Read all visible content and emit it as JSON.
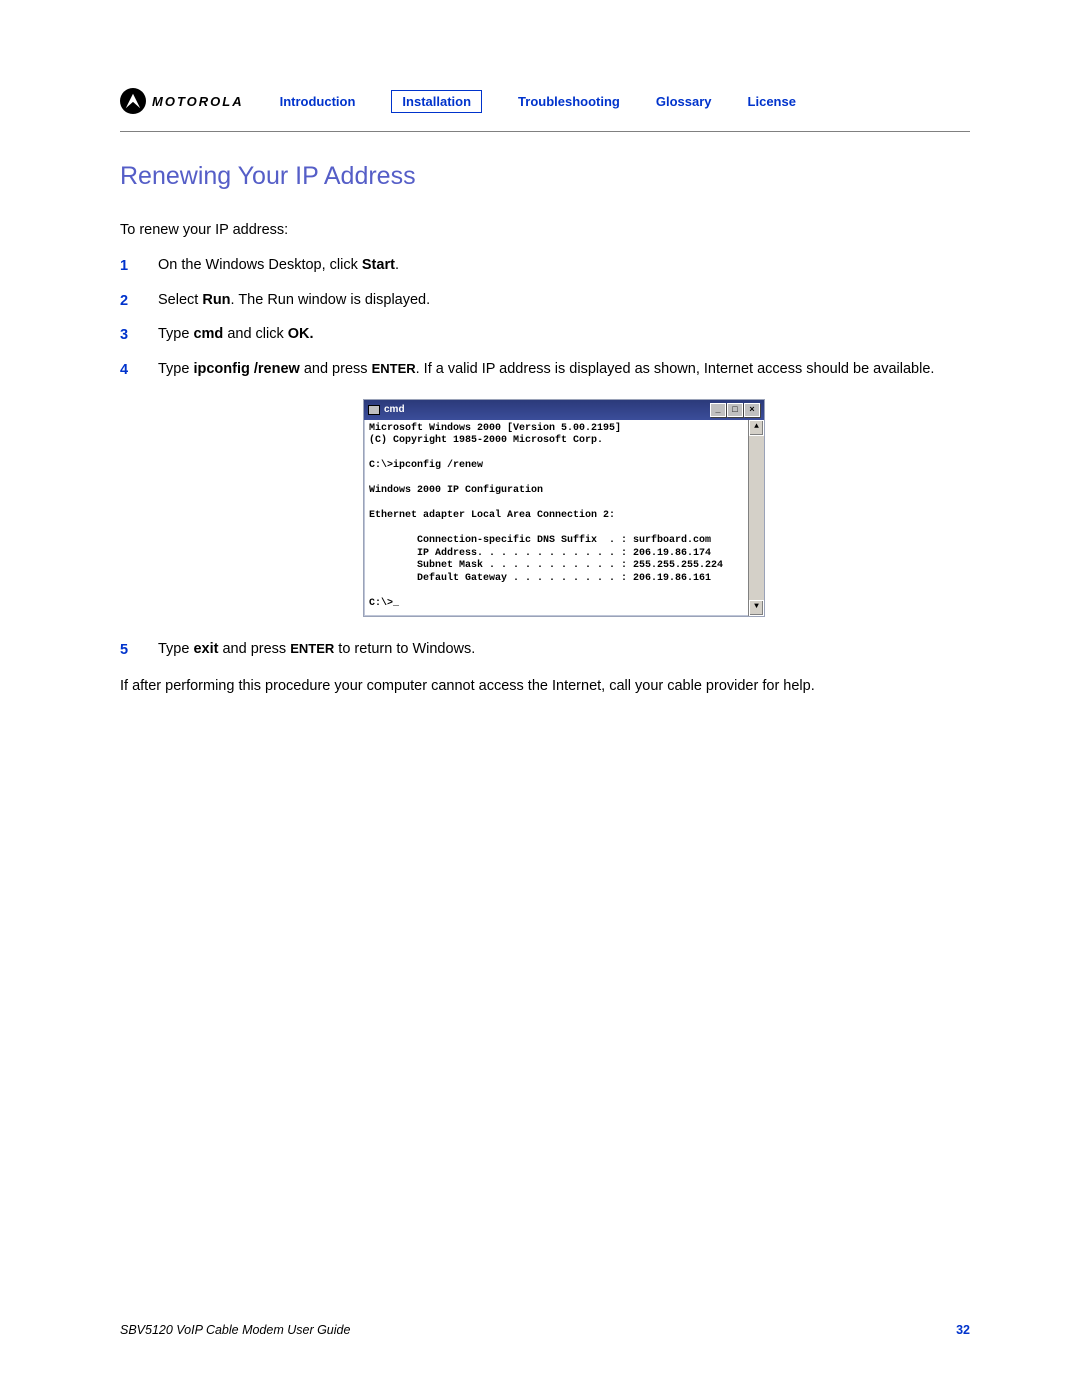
{
  "brand": "MOTOROLA",
  "nav": {
    "items": [
      {
        "label": "Introduction",
        "active": false
      },
      {
        "label": "Installation",
        "active": true
      },
      {
        "label": "Troubleshooting",
        "active": false
      },
      {
        "label": "Glossary",
        "active": false
      },
      {
        "label": "License",
        "active": false
      }
    ]
  },
  "title": "Renewing Your IP Address",
  "intro": "To renew your IP address:",
  "steps": [
    {
      "num": "1",
      "pre": "On the Windows Desktop, click ",
      "b1": "Start",
      "post": "."
    },
    {
      "num": "2",
      "pre": "Select ",
      "b1": "Run",
      "post": ". The Run window is displayed."
    },
    {
      "num": "3",
      "pre": "Type ",
      "b1": "cmd",
      "mid": " and click ",
      "b2": "OK."
    },
    {
      "num": "4",
      "pre": "Type ",
      "b1": "ipconfig /renew",
      "mid": " and press ",
      "sc": "ENTER",
      "post": ". If a valid IP address is displayed as shown, Internet access should be available."
    },
    {
      "num": "5",
      "pre": "Type ",
      "b1": "exit",
      "mid": " and press ",
      "sc": "ENTER",
      "post": " to return to Windows."
    }
  ],
  "cmd": {
    "title": "cmd",
    "lines": "Microsoft Windows 2000 [Version 5.00.2195]\n(C) Copyright 1985-2000 Microsoft Corp.\n\nC:\\>ipconfig /renew\n\nWindows 2000 IP Configuration\n\nEthernet adapter Local Area Connection 2:\n\n        Connection-specific DNS Suffix  . : surfboard.com\n        IP Address. . . . . . . . . . . . : 206.19.86.174\n        Subnet Mask . . . . . . . . . . . : 255.255.255.224\n        Default Gateway . . . . . . . . . : 206.19.86.161\n\nC:\\>_"
  },
  "after": "If after performing this procedure your computer cannot access the Internet, call your cable provider for help.",
  "footer": {
    "doc": "SBV5120 VoIP Cable Modem User Guide",
    "page": "32"
  }
}
